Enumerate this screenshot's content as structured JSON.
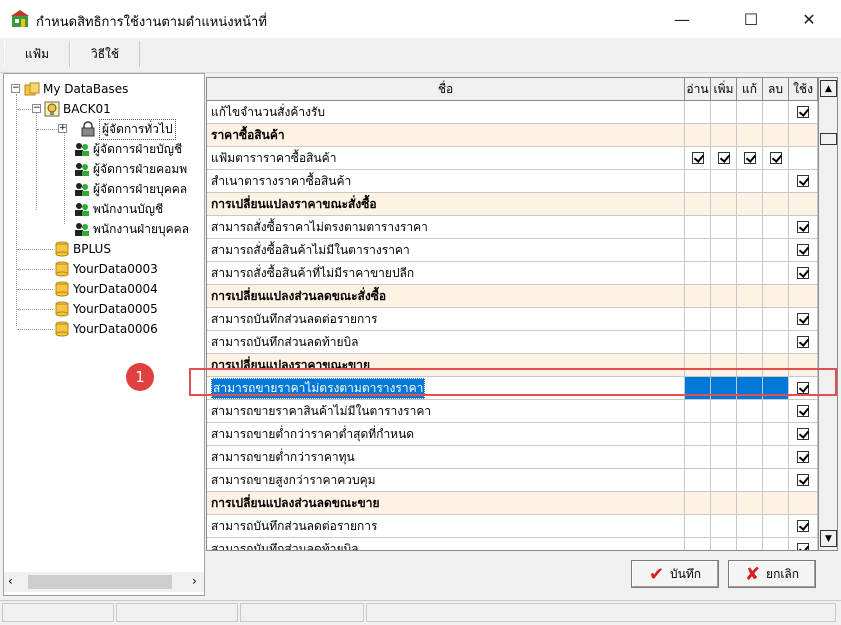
{
  "window": {
    "title": "กำหนดสิทธิการใช้งานตามตำแหน่งหน้าที่",
    "minimize": "—",
    "maximize": "☐",
    "close": "✕"
  },
  "menu": [
    "แฟ้ม",
    "วิธีใช้"
  ],
  "tree": {
    "root": "My DataBases",
    "db1": "BACK01",
    "groups": [
      "ผู้จัดการทั่วไป",
      "ผู้จัดการฝ่ายบัญชี",
      "ผู้จัดการฝ่ายคอมพ",
      "ผู้จัดการฝ่ายบุคคล",
      "พนักงานบัญชี",
      "พนักงานฝ่ายบุคคล"
    ],
    "others": [
      "BPLUS",
      "YourData0003",
      "YourData0004",
      "YourData0005",
      "YourData0006"
    ]
  },
  "grid": {
    "headers": [
      "ชื่อ",
      "อ่าน",
      "เพิ่ม",
      "แก้",
      "ลบ",
      "ใช้ง"
    ],
    "rows": [
      {
        "name": "แก้ไขจำนวนสั่งค้างรับ",
        "section": false,
        "checks": [
          false,
          false,
          false,
          false,
          true
        ]
      },
      {
        "name": "ราคาซื้อสินค้า",
        "section": true,
        "checks": null
      },
      {
        "name": "แฟ้มตาราราคาซื้อสินค้า",
        "section": false,
        "checks": [
          true,
          true,
          true,
          true,
          null
        ]
      },
      {
        "name": "สำเนาตารางราคาซื้อสินค้า",
        "section": false,
        "checks": [
          false,
          false,
          false,
          false,
          true
        ]
      },
      {
        "name": "การเปลี่ยนแปลงราคาขณะสั่งซื้อ",
        "section": true,
        "checks": null
      },
      {
        "name": "สามารถสั่งซื้อราคาไม่ตรงตามตารางราคา",
        "section": false,
        "checks": [
          false,
          false,
          false,
          false,
          true
        ]
      },
      {
        "name": "สามารถสั่งซื้อสินค้าไม่มีในตารางราคา",
        "section": false,
        "checks": [
          false,
          false,
          false,
          false,
          true
        ]
      },
      {
        "name": "สามารถสั่งซื้อสินค้าที่ไม่มีราคาขายปลีก",
        "section": false,
        "checks": [
          false,
          false,
          false,
          false,
          true
        ]
      },
      {
        "name": "การเปลี่ยนแปลงส่วนลดขณะสั่งซื้อ",
        "section": true,
        "checks": null
      },
      {
        "name": "สามารถบันทึกส่วนลดต่อรายการ",
        "section": false,
        "checks": [
          false,
          false,
          false,
          false,
          true
        ]
      },
      {
        "name": "สามารถบันทึกส่วนลดท้ายบิล",
        "section": false,
        "checks": [
          false,
          false,
          false,
          false,
          true
        ]
      },
      {
        "name": "การเปลี่ยนแปลงราคาขณะขาย",
        "section": true,
        "checks": null
      },
      {
        "name": "สามารถขายราคาไม่ตรงตามตารางราคา",
        "section": false,
        "selected": true,
        "checks": [
          false,
          false,
          false,
          false,
          true
        ]
      },
      {
        "name": "สามารถขายราคาสินค้าไม่มีในตารางราคา",
        "section": false,
        "checks": [
          false,
          false,
          false,
          false,
          true
        ]
      },
      {
        "name": "สามารถขายต่ำกว่าราคาต่ำสุดที่กำหนด",
        "section": false,
        "checks": [
          false,
          false,
          false,
          false,
          true
        ]
      },
      {
        "name": "สามารถขายต่ำกว่าราคาทุน",
        "section": false,
        "checks": [
          false,
          false,
          false,
          false,
          true
        ]
      },
      {
        "name": "สามารถขายสูงกว่าราคาควบคุม",
        "section": false,
        "checks": [
          false,
          false,
          false,
          false,
          true
        ]
      },
      {
        "name": "การเปลี่ยนแปลงส่วนลดขณะขาย",
        "section": true,
        "checks": null
      },
      {
        "name": "สามารถบันทึกส่วนลดต่อรายการ",
        "section": false,
        "checks": [
          false,
          false,
          false,
          false,
          true
        ]
      },
      {
        "name": "สามารถบันทึกส่วนลดท้ายบิล",
        "section": false,
        "checks": [
          false,
          false,
          false,
          false,
          true
        ]
      }
    ]
  },
  "annotation": {
    "badge": "1"
  },
  "buttons": {
    "save": "บันทึก",
    "cancel": "ยกเลิก"
  },
  "colors": {
    "selection": "#0078d7",
    "section_bg": "#fdf2e3",
    "annotation": "#e04040"
  }
}
